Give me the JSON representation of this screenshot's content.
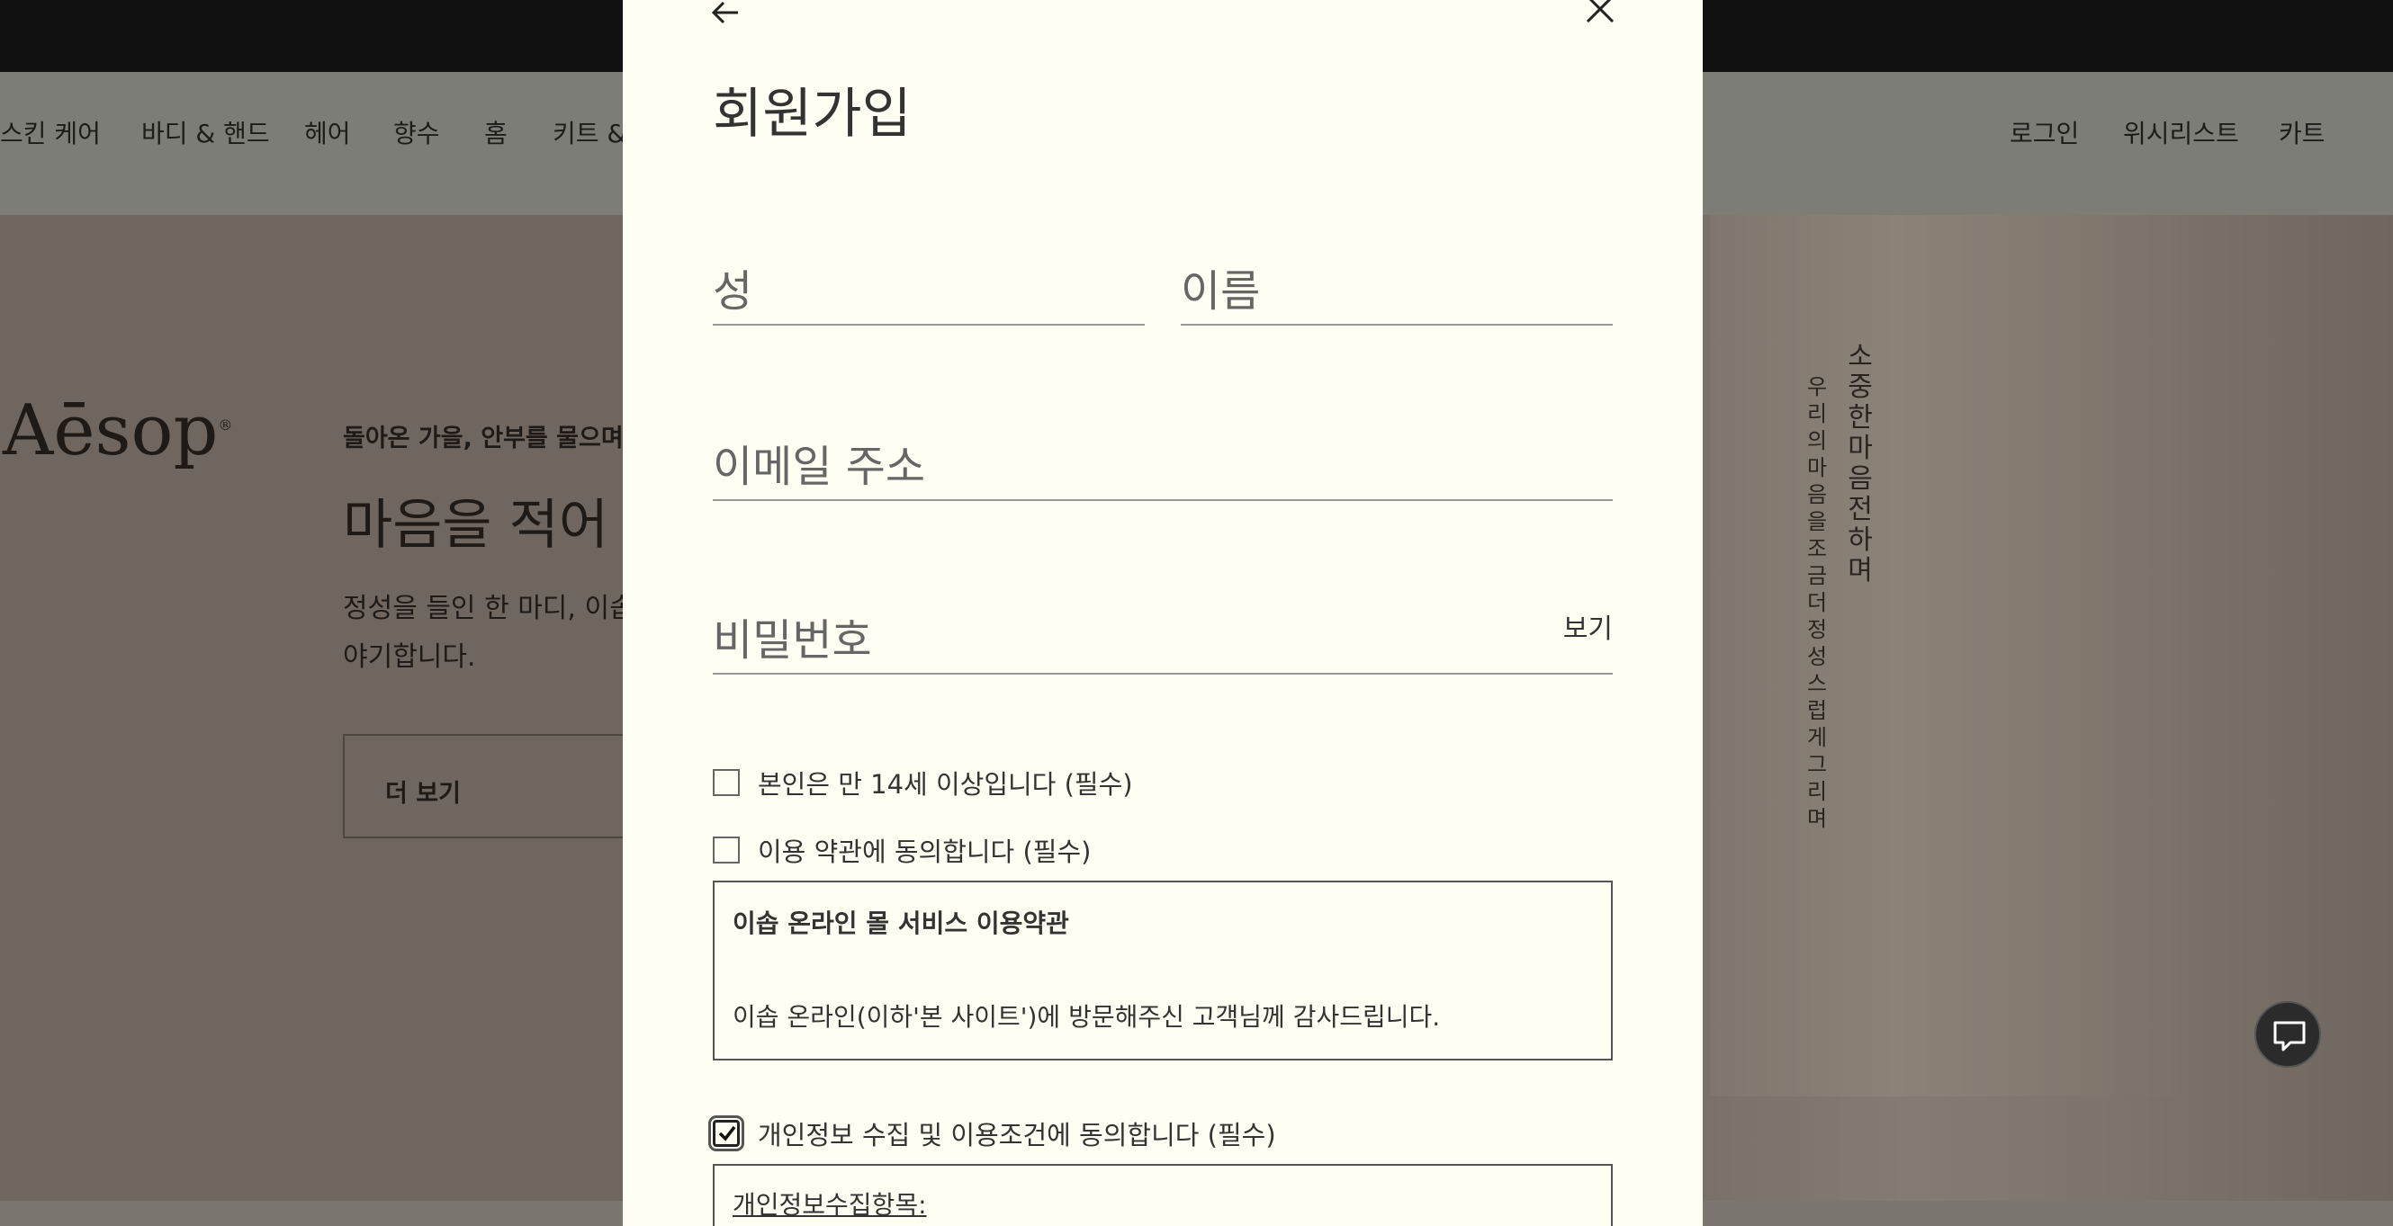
{
  "nav": {
    "items": [
      "스킨 케어",
      "바디 & 핸드",
      "헤어",
      "향수",
      "홈",
      "키트 &"
    ],
    "account": [
      "로그인",
      "위시리스트",
      "카트"
    ]
  },
  "hero": {
    "logo": "Aēsop",
    "logo_mark": "®",
    "eyebrow": "돌아온 가을, 안부를 물으며",
    "headline": "마음을 적어 건",
    "body_line1": "정성을 들인 한 마디, 이솝",
    "body_line2": "야기합니다.",
    "cta": "더 보기",
    "calligraphy_col1": "소중한 마음 전하며",
    "calligraphy_col2": "우리의 마음을 조금 더 정성스럽게 그리며"
  },
  "modal": {
    "title": "회원가입",
    "last_name_placeholder": "성",
    "first_name_placeholder": "이름",
    "email_placeholder": "이메일 주소",
    "password_placeholder": "비밀번호",
    "show_password": "보기",
    "age_check": "본인은 만 14세 이상입니다 (필수)",
    "terms_check": "이용 약관에 동의합니다 (필수)",
    "terms_title": "이솝 온라인 몰 서비스 이용약관",
    "terms_text": "이솝 온라인(이하'본 사이트')에 방문해주신 고객님께 감사드립니다.",
    "privacy_check": "개인정보 수집 및 이용조건에 동의합니다 (필수)",
    "privacy_link": "개인정보수집항목",
    "privacy_colon": ":"
  },
  "icons": {
    "back": "arrow-left-icon",
    "close": "close-icon",
    "chat": "chat-icon",
    "check": "check-icon"
  }
}
